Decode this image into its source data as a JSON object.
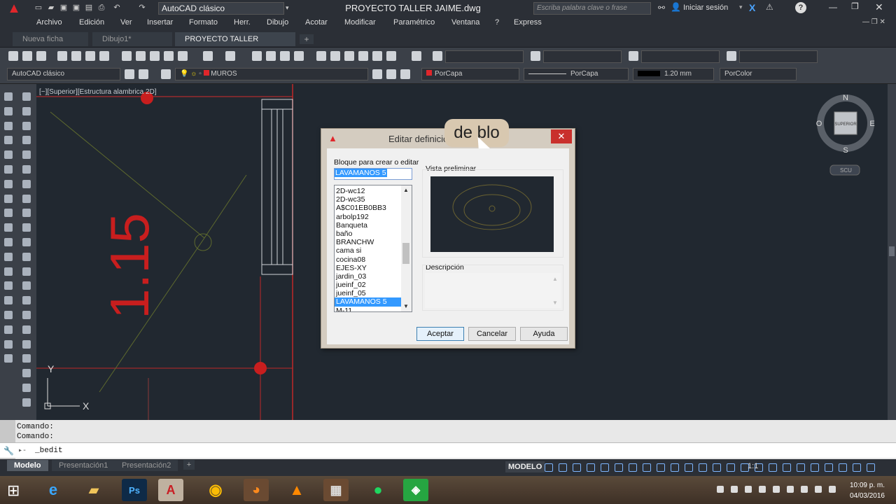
{
  "app": {
    "workspace": "AutoCAD clásico",
    "document_title": "PROYECTO TALLER JAIME.dwg",
    "search_placeholder": "Escriba palabra clave o frase",
    "login": "Iniciar sesión"
  },
  "menu": [
    "Archivo",
    "Edición",
    "Ver",
    "Insertar",
    "Formato",
    "Herr.",
    "Dibujo",
    "Acotar",
    "Modificar",
    "Paramétrico",
    "Ventana",
    "?",
    "Express"
  ],
  "doc_tabs": [
    {
      "label": "Nueva ficha",
      "active": false
    },
    {
      "label": "Dibujo1*",
      "active": false
    },
    {
      "label": "PROYECTO TALLER JAIME*",
      "active": true
    }
  ],
  "toolbar2": {
    "workspace_combo": "AutoCAD clásico",
    "layer": "MUROS",
    "color": "PorCapa",
    "linetype": "PorCapa",
    "lineweight": "1.20 mm",
    "plotstyle": "PorColor"
  },
  "viewport_label": "[−][Superior][Estructura alambrica 2D]",
  "drawing": {
    "dimension_text": "1.15",
    "ucs_y": "Y",
    "ucs_x": "X"
  },
  "viewcube": {
    "north": "N",
    "south": "S",
    "east": "E",
    "west": "O",
    "face": "SUPERIOR",
    "ucs": "SCU"
  },
  "dialog": {
    "title": "Editar definición de bloque",
    "overlay_zoom_text": "de blo",
    "block_label": "Bloque para crear o editar",
    "block_value": "LAVAMANOS 5",
    "blocks": [
      "2D-wc12",
      "2D-wc35",
      "A$C01EB0BB3",
      "arbolp192",
      "Banqueta",
      "baño",
      "BRANCHW",
      "cama si",
      "cocina08",
      "EJES-XY",
      "jardin_03",
      "jueinf_02",
      "jueinf_05",
      "LAVAMANOS 5",
      "M-11"
    ],
    "selected_block": "LAVAMANOS 5",
    "preview_label": "Vista preliminar",
    "description_label": "Descripción",
    "ok": "Aceptar",
    "cancel": "Cancelar",
    "help": "Ayuda"
  },
  "command": {
    "history": [
      "Comando:",
      "Comando:"
    ],
    "prompt": "_bedit"
  },
  "layout_tabs": [
    {
      "label": "Modelo",
      "active": true
    },
    {
      "label": "Presentación1",
      "active": false
    },
    {
      "label": "Presentación2",
      "active": false
    }
  ],
  "status": {
    "mode": "MODELO",
    "scale": "1:1"
  },
  "taskbar": {
    "time": "10:09 p. m.",
    "date": "04/03/2016"
  },
  "colors": {
    "accent_red": "#e0262b",
    "canvas": "#212830",
    "selection": "#3399ff"
  }
}
